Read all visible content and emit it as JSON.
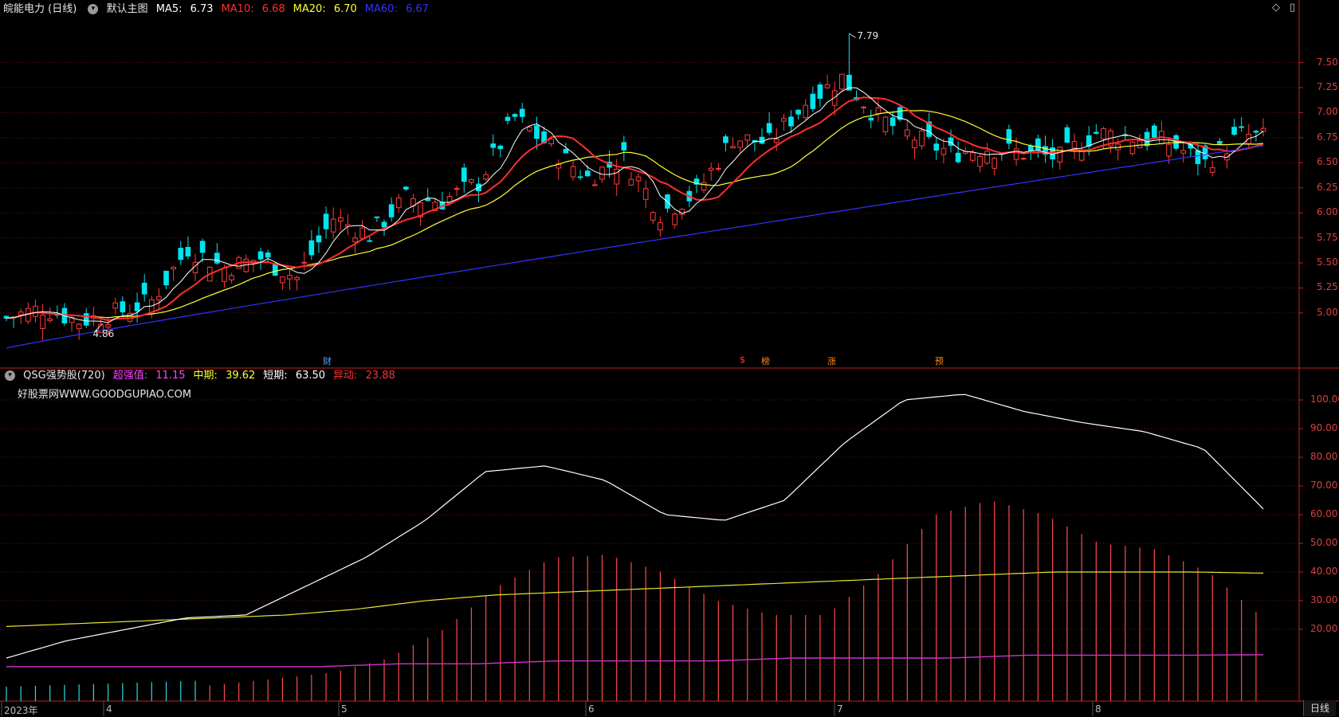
{
  "header": {
    "stock_name": "皖能电力 (日线)",
    "main_chart_label": "默认主图",
    "ma": [
      {
        "label": "MA5:",
        "value": "6.73",
        "color": "#ffffff"
      },
      {
        "label": "MA10:",
        "value": "6.68",
        "color": "#ff2e2e"
      },
      {
        "label": "MA20:",
        "value": "6.70",
        "color": "#ffff33"
      },
      {
        "label": "MA60:",
        "value": "6.67",
        "color": "#3333ff"
      }
    ]
  },
  "indicator": {
    "name": "QSG强势股(720)",
    "items": [
      {
        "label": "超强值:",
        "value": "11.15",
        "color": "#ff44ff"
      },
      {
        "label": "中期:",
        "value": "39.62",
        "color": "#ffff33"
      },
      {
        "label": "短期:",
        "value": "63.50",
        "color": "#ffffff"
      },
      {
        "label": "异动:",
        "value": "23.88",
        "color": "#ff3030"
      }
    ],
    "watermark": "好股票网WWW.GOODGUPIAO.COM"
  },
  "annotations": {
    "high": "7.79",
    "low": "4.86"
  },
  "event_markers": [
    {
      "label": "财",
      "color": "#5aa0ff"
    },
    {
      "label": "$",
      "color": "#ff4040"
    },
    {
      "label": "榜",
      "color": "#ff8c1a"
    },
    {
      "label": "涨",
      "color": "#ff8c1a"
    },
    {
      "label": "预",
      "color": "#ff8c1a"
    }
  ],
  "x_axis": [
    "2023年",
    "4",
    "5",
    "6",
    "7",
    "8"
  ],
  "period_button": "日线",
  "colors": {
    "up": "#ff3b3b",
    "down": "#00e5ee",
    "grid": "#7a1010",
    "axis": "#c81e1e"
  },
  "chart_data": [
    {
      "type": "candlestick",
      "title": "皖能电力 (日线)",
      "y_ticks": [
        5.0,
        5.25,
        5.5,
        5.75,
        6.0,
        6.25,
        6.5,
        6.75,
        7.0,
        7.25,
        7.5
      ],
      "ylim": [
        4.45,
        7.95
      ],
      "series_names": [
        "MA5",
        "MA10",
        "MA20",
        "MA60"
      ],
      "high": 7.79,
      "low": 4.86,
      "ma60_start": 4.65,
      "ma60_end": 6.67,
      "close_anchors": [
        [
          0,
          4.95
        ],
        [
          5,
          5.05
        ],
        [
          10,
          4.92
        ],
        [
          15,
          5.0
        ],
        [
          20,
          5.12
        ],
        [
          25,
          5.65
        ],
        [
          30,
          5.45
        ],
        [
          35,
          5.55
        ],
        [
          40,
          5.35
        ],
        [
          45,
          5.95
        ],
        [
          50,
          5.78
        ],
        [
          55,
          6.15
        ],
        [
          60,
          6.12
        ],
        [
          65,
          6.3
        ],
        [
          70,
          6.95
        ],
        [
          75,
          6.65
        ],
        [
          80,
          6.35
        ],
        [
          85,
          6.55
        ],
        [
          90,
          6.0
        ],
        [
          95,
          6.2
        ],
        [
          100,
          6.75
        ],
        [
          105,
          6.7
        ],
        [
          110,
          7.1
        ],
        [
          115,
          7.35
        ],
        [
          120,
          6.95
        ],
        [
          125,
          6.75
        ],
        [
          130,
          6.6
        ],
        [
          135,
          6.65
        ],
        [
          140,
          6.6
        ],
        [
          145,
          6.55
        ],
        [
          150,
          6.8
        ],
        [
          155,
          6.75
        ],
        [
          160,
          6.7
        ],
        [
          165,
          6.5
        ],
        [
          170,
          6.78
        ],
        [
          173,
          6.75
        ]
      ]
    },
    {
      "type": "line",
      "title": "QSG强势股(720)",
      "y_ticks": [
        20,
        30,
        40,
        50,
        60,
        70,
        80,
        90,
        100
      ],
      "ylim": [
        -5,
        110
      ],
      "series": [
        {
          "name": "短期",
          "values": [
            10,
            16,
            20,
            24,
            25,
            35,
            45,
            58,
            75,
            77,
            72,
            60,
            58,
            65,
            85,
            100,
            102,
            96,
            92,
            89,
            83,
            62
          ]
        },
        {
          "name": "中期",
          "values": [
            21,
            22,
            23,
            24,
            25,
            27,
            30,
            32,
            33,
            34,
            35,
            36,
            37,
            38,
            39,
            40,
            40,
            40,
            39.6
          ]
        },
        {
          "name": "超强值",
          "values": [
            7,
            7,
            7,
            7,
            7,
            8,
            8,
            9,
            9,
            9,
            10,
            10,
            10,
            11,
            11,
            11,
            11.15
          ]
        },
        {
          "name": "异动",
          "values": [
            -7,
            -5,
            -3,
            -1,
            1,
            3,
            5,
            10,
            20,
            35,
            45,
            46,
            40,
            30,
            25,
            25,
            40,
            60,
            65,
            60,
            50,
            48,
            40,
            23.88
          ]
        }
      ]
    }
  ]
}
